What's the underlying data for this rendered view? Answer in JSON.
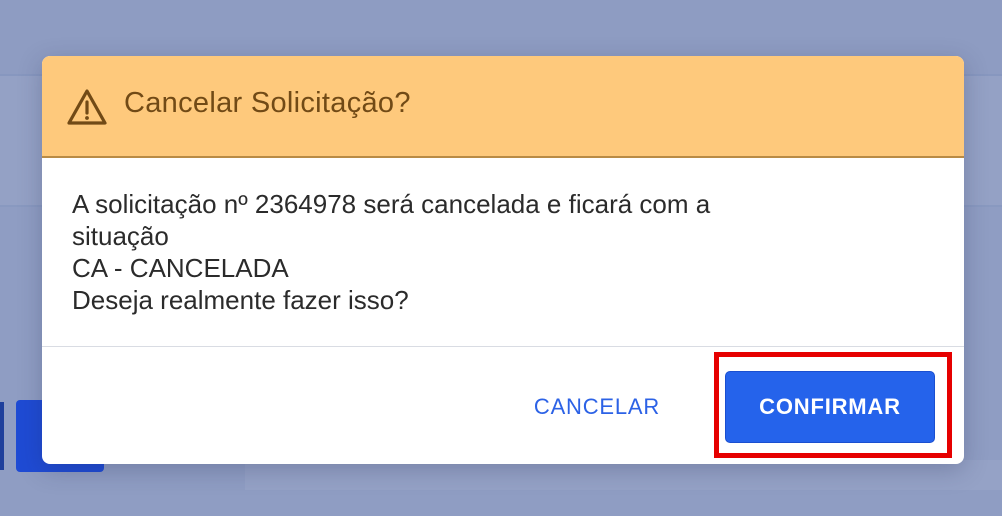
{
  "dialog": {
    "title": "Cancelar Solicitação?",
    "icon": "warning-triangle-icon",
    "message_lines": [
      "A solicitação nº 2364978 será cancelada e ficará com a",
      "situação",
      "CA - CANCELADA",
      "Deseja realmente fazer isso?"
    ],
    "cancel_label": "CANCELAR",
    "confirm_label": "CONFIRMAR"
  },
  "colors": {
    "header_bg": "#fec97c",
    "header_text": "#714a16",
    "primary": "#2563eb",
    "highlight": "#e60000",
    "overlay": "#8f9dc3"
  }
}
